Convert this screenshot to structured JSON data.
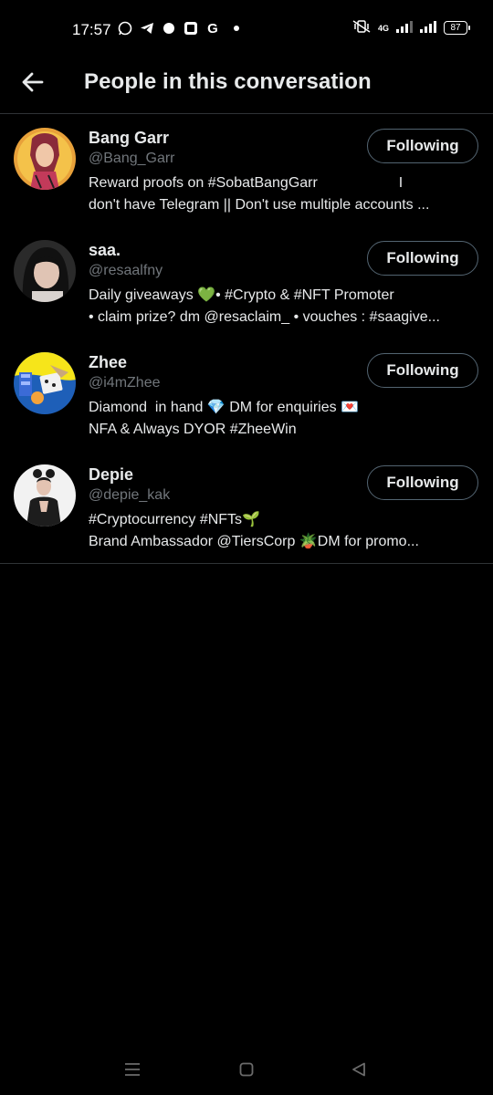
{
  "status_bar": {
    "time": "17:57",
    "notification_icons": [
      "whatsapp-icon",
      "telegram-icon",
      "chat-icon",
      "app-icon",
      "google-icon"
    ],
    "network": "4G",
    "battery": "87"
  },
  "header": {
    "title": "People in this conversation",
    "back_icon": "arrow-left-icon"
  },
  "users": [
    {
      "name": "Bang Garr",
      "handle": "@Bang_Garr",
      "bio_line1": "Reward proofs on #SobatBangGarr                    I",
      "bio_line2": "don't have Telegram || Don't use multiple accounts ...",
      "button": "Following"
    },
    {
      "name": "saa.",
      "handle": "@resaalfny",
      "bio_line1": "Daily giveaways 💚• #Crypto & #NFT Promoter",
      "bio_line2": "• claim prize? dm @resaclaim_ • vouches : #saagive...",
      "button": "Following"
    },
    {
      "name": "Zhee",
      "handle": "@i4mZhee",
      "bio_line1": "Diamond  in hand 💎 DM for enquiries 💌",
      "bio_line2": "NFA & Always DYOR #ZheeWin",
      "button": "Following"
    },
    {
      "name": "Depie",
      "handle": "@depie_kak",
      "bio_line1": "#Cryptocurrency #NFTs🌱",
      "bio_line2": "Brand Ambassador @TiersCorp 🪴DM for promo...",
      "button": "Following"
    }
  ],
  "nav_bar": [
    "menu-icon",
    "home-square-icon",
    "back-triangle-icon"
  ]
}
